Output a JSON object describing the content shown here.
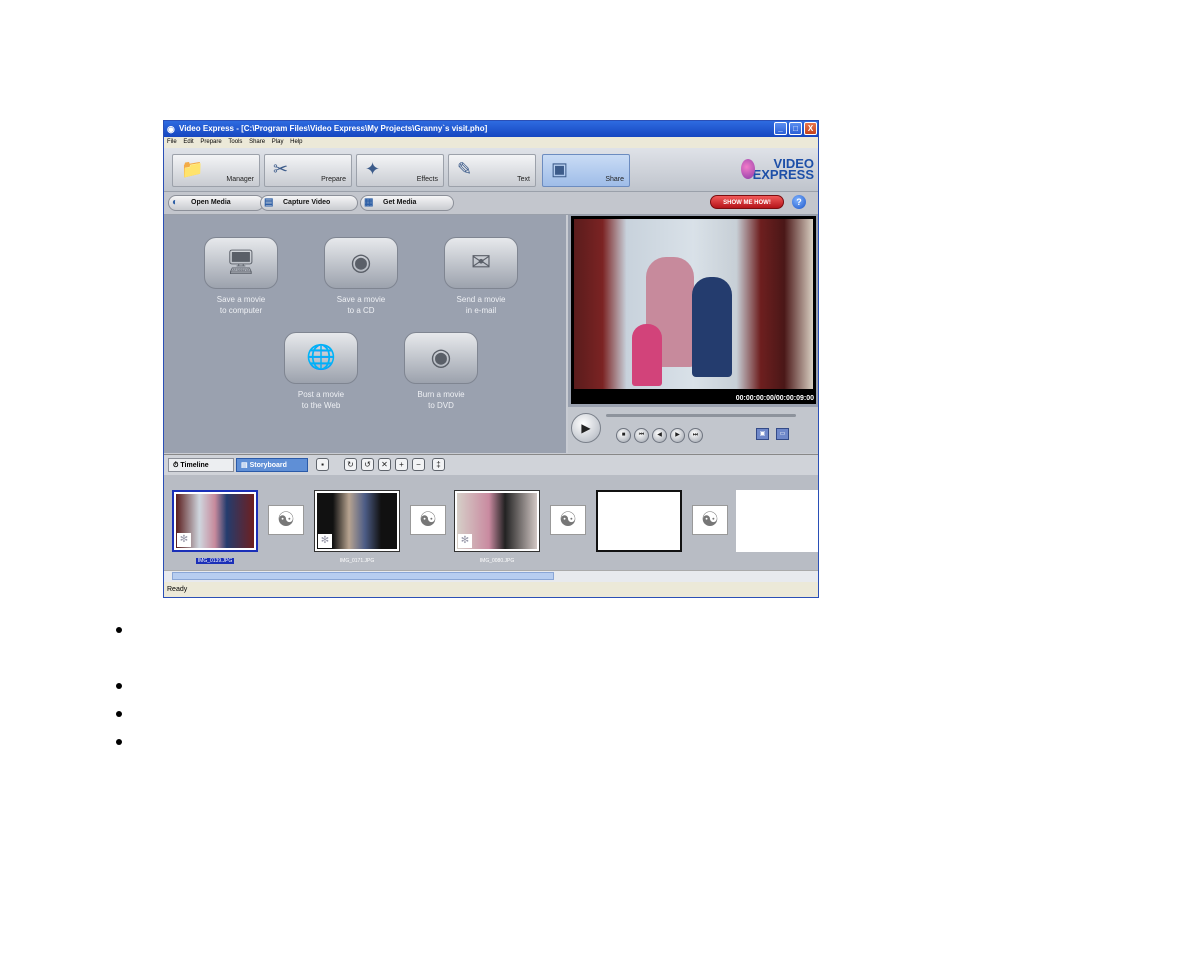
{
  "window": {
    "title": "Video Express - [C:\\Program Files\\Video Express\\My Projects\\Granny`s visit.pho]",
    "controls": {
      "minimize": "_",
      "maximize": "□",
      "close": "X"
    }
  },
  "menu": [
    "File",
    "Edit",
    "Prepare",
    "Tools",
    "Share",
    "Play",
    "Help"
  ],
  "modes": [
    {
      "label": "Manager",
      "icon": "manager-icon",
      "glyph": "📁"
    },
    {
      "label": "Prepare",
      "icon": "prepare-icon",
      "glyph": "✂"
    },
    {
      "label": "Effects",
      "icon": "effects-icon",
      "glyph": "✦"
    },
    {
      "label": "Text",
      "icon": "text-icon",
      "glyph": "✎"
    },
    {
      "label": "Share",
      "icon": "share-icon",
      "glyph": "▣"
    }
  ],
  "logo": {
    "line1": "VIDEO",
    "line2": "EXPRESS"
  },
  "actions": {
    "open_media": "Open Media",
    "capture_video": "Capture Video",
    "get_media": "Get Media",
    "show_me_how": "SHOW ME HOW!",
    "help": "?"
  },
  "share_tasks": [
    {
      "line1": "Save a movie",
      "line2": "to computer",
      "glyph": "🖥"
    },
    {
      "line1": "Save a movie",
      "line2": "to a CD",
      "glyph": "◉"
    },
    {
      "line1": "Send a movie",
      "line2": "in e-mail",
      "glyph": "✉"
    },
    {
      "line1": "Post a movie",
      "line2": "to the Web",
      "glyph": "🌐"
    },
    {
      "line1": "Burn a movie",
      "line2": "to DVD",
      "glyph": "◉"
    }
  ],
  "preview": {
    "timecode": "00:00:00:00/00:00:09:00"
  },
  "timeline_bar": {
    "timeline_tab": "Timeline",
    "storyboard_tab": "Storyboard"
  },
  "clips": [
    {
      "label": "IMG_0139.JPG",
      "selected": true
    },
    {
      "label": "IMG_0171.JPG",
      "selected": false
    },
    {
      "label": "IMG_0080.JPG",
      "selected": false
    },
    {
      "label": "",
      "selected": false
    },
    {
      "label": "",
      "selected": false
    }
  ],
  "status": {
    "text": "Ready"
  },
  "colors": {
    "title_bar": "#1f55cc",
    "accent_share": "#9fbde8",
    "show_me_how": "#d0252b"
  }
}
